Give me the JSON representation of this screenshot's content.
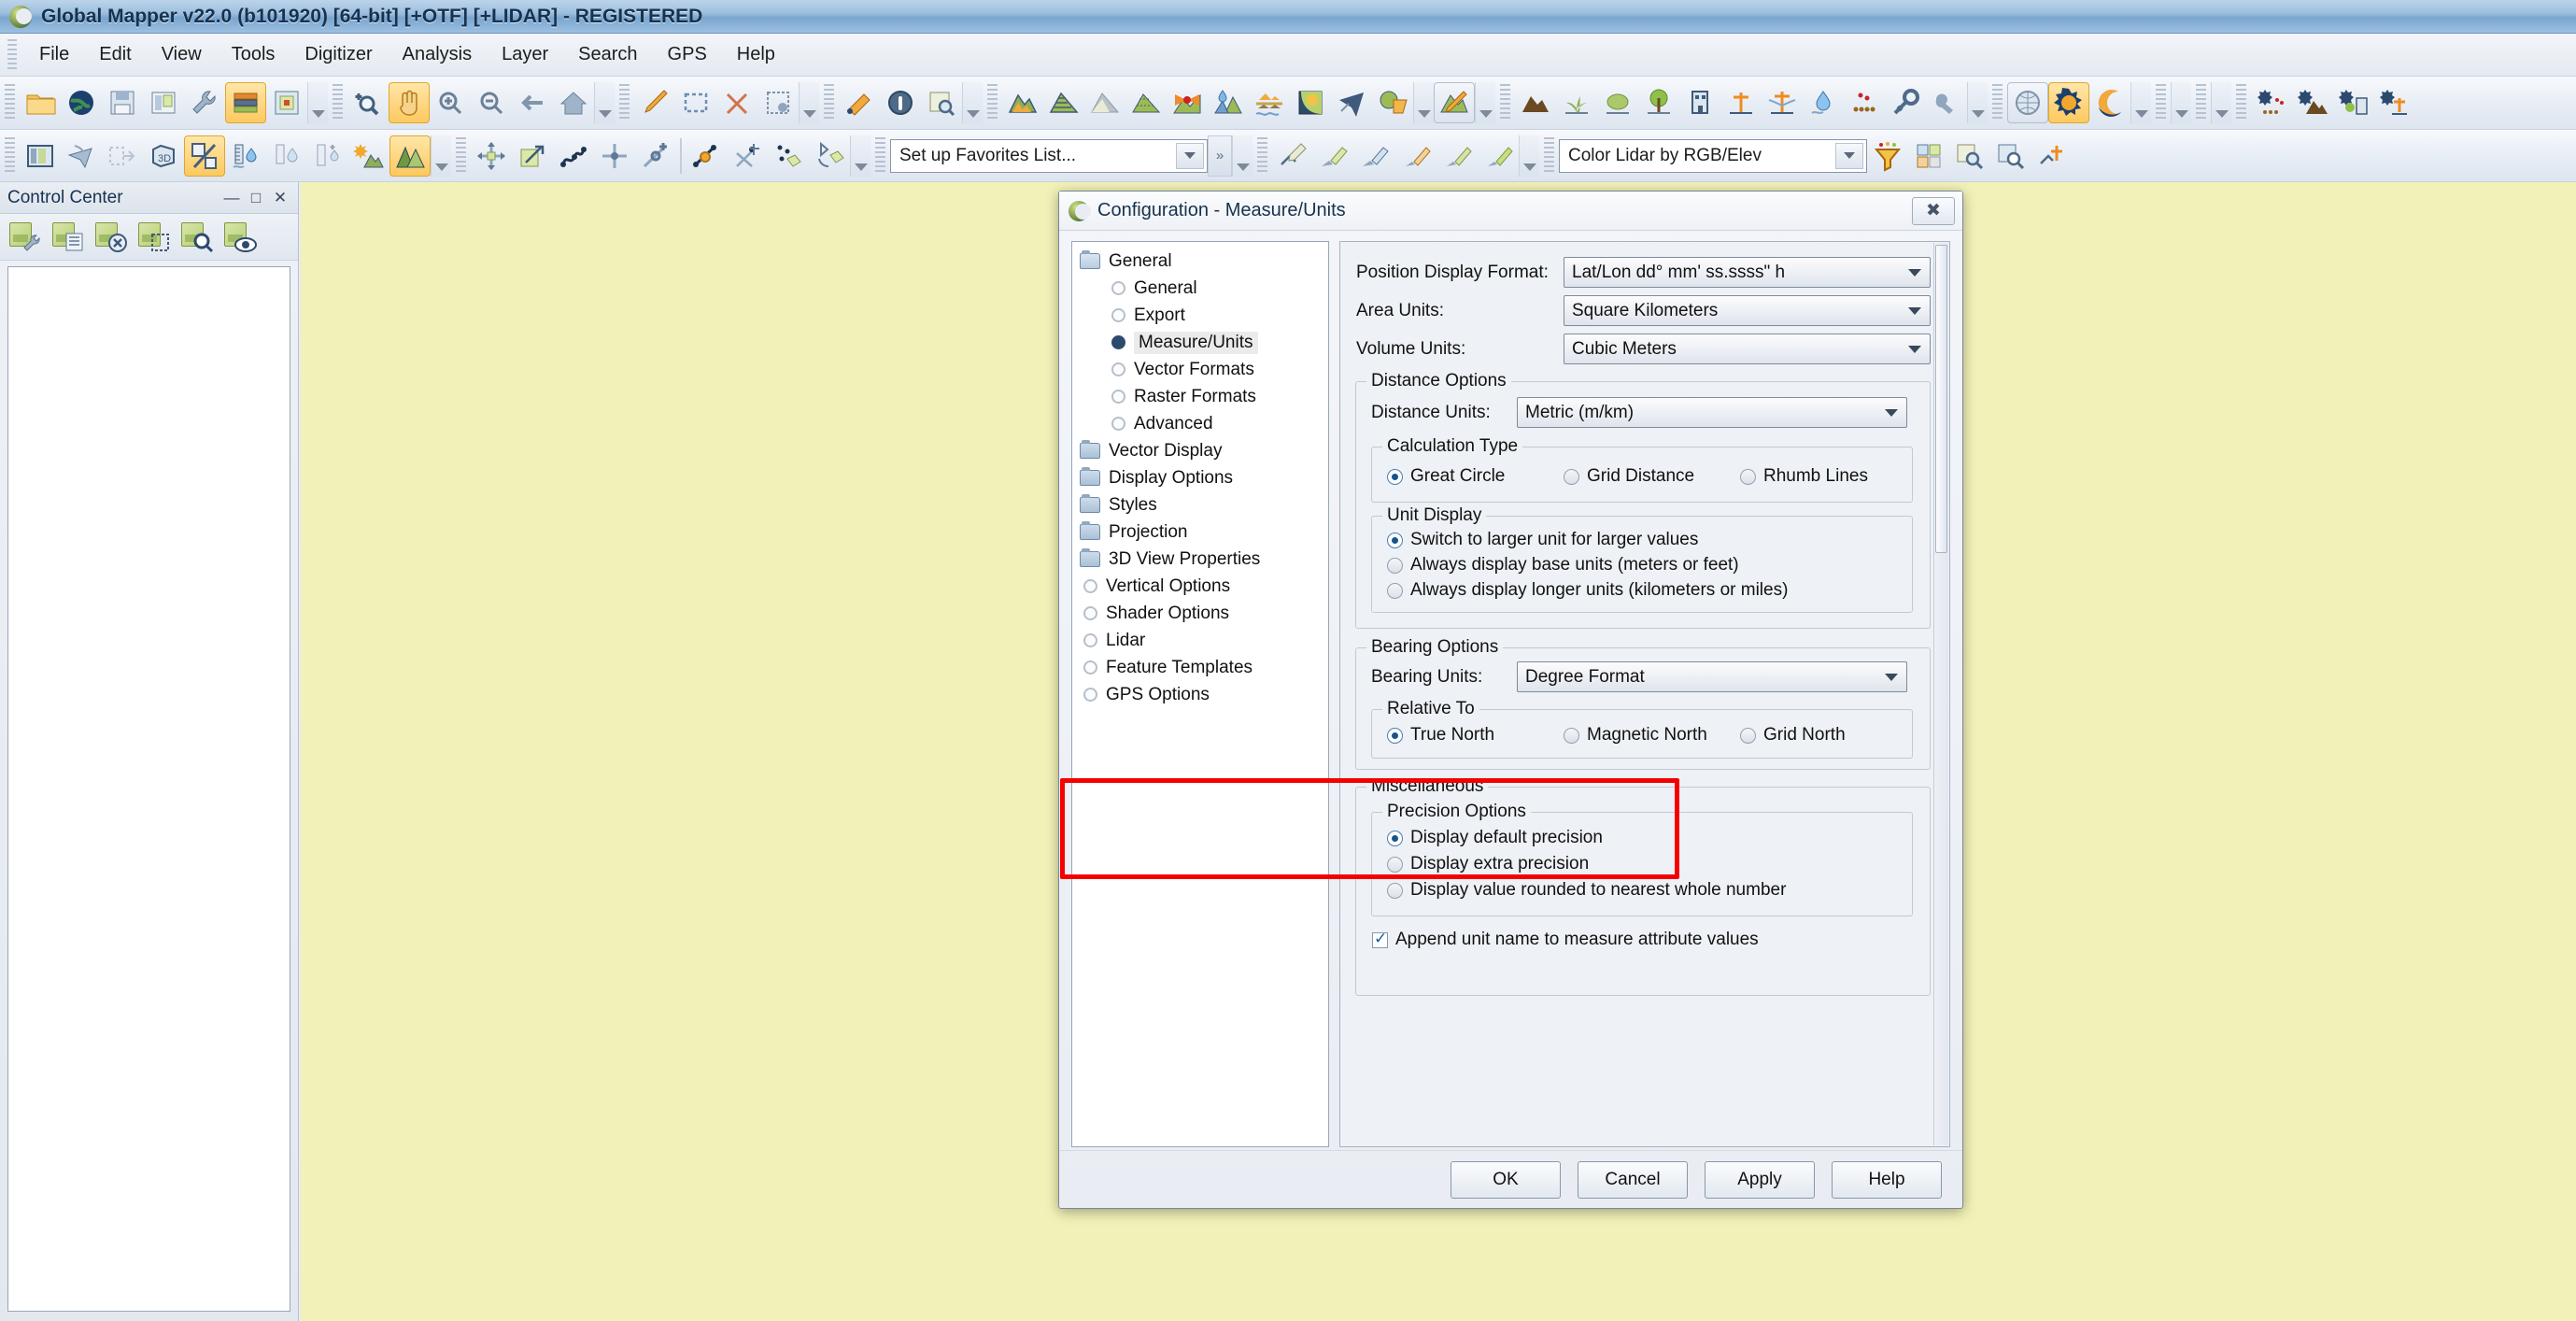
{
  "window": {
    "title": "Global Mapper v22.0 (b101920) [64-bit] [+OTF] [+LIDAR] - REGISTERED",
    "logo_icon": "globalmapper-logo-icon"
  },
  "menubar": {
    "items": [
      "File",
      "Edit",
      "View",
      "Tools",
      "Digitizer",
      "Analysis",
      "Layer",
      "Search",
      "GPS",
      "Help"
    ]
  },
  "toolbars": {
    "favorites_combo": {
      "value": "Set up Favorites List...",
      "placeholder": "Set up Favorites List..."
    },
    "lidar_combo": {
      "value": "Color Lidar by RGB/Elev",
      "placeholder": "Color Lidar by RGB/Elev"
    },
    "row1_icons": [
      "open-folder-icon",
      "open-data-online-icon",
      "save-workspace-icon",
      "print-icon",
      "configuration-wrench-icon",
      "control-center-icon",
      "overlay-control-icon",
      "zoom-select-icon",
      "pan-hand-icon",
      "zoom-in-icon",
      "zoom-out-icon",
      "back-arrow-icon",
      "full-view-home-icon",
      "digitizer-pencil-icon",
      "select-area-icon",
      "delete-feature-icon",
      "feature-info-icon",
      "measure-ruler-icon",
      "feature-info-circle-icon",
      "search-layer-icon",
      "terrain-layer-icon",
      "contour-icon",
      "shaded-relief-icon",
      "elevation-grid-icon",
      "view-shed-icon",
      "watershed-icon",
      "water-level-icon",
      "sun-shading-icon",
      "flight-path-icon",
      "combine-terrain-icon",
      "paint-terrain-icon",
      "mountain-point-icon",
      "grass-point-icon",
      "shrub-point-icon",
      "tree-point-icon",
      "building-point-icon",
      "utility-pole-icon",
      "power-line-icon",
      "water-drop-icon",
      "point-cloud-icon",
      "key-point-icon",
      "globe-view-icon",
      "gear-sun-icon",
      "moon-crescent-icon",
      "point-cloud-settings-icon",
      "terrain-settings-icon",
      "building-settings-icon",
      "pole-settings-icon"
    ],
    "row2_icons": [
      "control-center-panel-icon",
      "flight-path-2-icon",
      "export-bounds-icon",
      "three-d-view-icon",
      "percent-slope-icon",
      "water-gauge-icon",
      "water-gauge-2-icon",
      "water-gauge-3-icon",
      "sun-terrain-icon",
      "terrain-pair-icon",
      "pan-move-icon",
      "scale-move-icon",
      "path-profile-icon",
      "move-feature-icon",
      "rotate-feature-icon",
      "add-vertex-icon",
      "cut-feature-icon",
      "smooth-feature-icon",
      "rotate-shape-icon"
    ]
  },
  "control_center": {
    "title": "Control Center",
    "window_buttons": [
      "minimize",
      "maximize",
      "close"
    ],
    "toolbar_icons": [
      "layer-options-icon",
      "layer-metadata-icon",
      "layer-close-icon",
      "layer-bounds-icon",
      "layer-zoom-icon",
      "layer-visibility-icon"
    ]
  },
  "dialog": {
    "title": "Configuration - Measure/Units",
    "title_icon": "globalmapper-logo-icon",
    "close_icon": "close-icon",
    "tree": [
      {
        "label": "General",
        "type": "folder-open",
        "level": 0,
        "selected": false
      },
      {
        "label": "General",
        "type": "radio",
        "level": 1,
        "selected": false
      },
      {
        "label": "Export",
        "type": "radio",
        "level": 1,
        "selected": false
      },
      {
        "label": "Measure/Units",
        "type": "radio",
        "level": 1,
        "selected": true
      },
      {
        "label": "Vector Formats",
        "type": "radio",
        "level": 1,
        "selected": false
      },
      {
        "label": "Raster Formats",
        "type": "radio",
        "level": 1,
        "selected": false
      },
      {
        "label": "Advanced",
        "type": "radio",
        "level": 1,
        "selected": false
      },
      {
        "label": "Vector Display",
        "type": "folder",
        "level": 0,
        "selected": false
      },
      {
        "label": "Display Options",
        "type": "folder",
        "level": 0,
        "selected": false
      },
      {
        "label": "Styles",
        "type": "folder",
        "level": 0,
        "selected": false
      },
      {
        "label": "Projection",
        "type": "folder",
        "level": 0,
        "selected": false
      },
      {
        "label": "3D View Properties",
        "type": "folder",
        "level": 0,
        "selected": false
      },
      {
        "label": "Vertical Options",
        "type": "radio",
        "level": 0,
        "selected": false
      },
      {
        "label": "Shader Options",
        "type": "radio",
        "level": 0,
        "selected": false
      },
      {
        "label": "Lidar",
        "type": "radio",
        "level": 0,
        "selected": false
      },
      {
        "label": "Feature Templates",
        "type": "radio",
        "level": 0,
        "selected": false
      },
      {
        "label": "GPS Options",
        "type": "radio",
        "level": 0,
        "selected": false
      }
    ],
    "fields": {
      "position_display_format": {
        "label": "Position Display Format:",
        "value": "Lat/Lon dd° mm' ss.ssss\" h"
      },
      "area_units": {
        "label": "Area Units:",
        "value": "Square Kilometers"
      },
      "volume_units": {
        "label": "Volume Units:",
        "value": "Cubic Meters"
      }
    },
    "distance_options": {
      "caption": "Distance Options",
      "distance_units": {
        "label": "Distance Units:",
        "value": "Metric (m/km)"
      },
      "calculation_type": {
        "caption": "Calculation Type",
        "options": [
          "Great Circle",
          "Grid Distance",
          "Rhumb Lines"
        ],
        "selected": "Great Circle"
      },
      "unit_display": {
        "caption": "Unit Display",
        "options": [
          "Switch to larger unit for larger values",
          "Always display base units (meters or feet)",
          "Always display longer units (kilometers or miles)"
        ],
        "selected": "Switch to larger unit for larger values"
      }
    },
    "bearing_options": {
      "caption": "Bearing Options",
      "bearing_units": {
        "label": "Bearing Units:",
        "value": "Degree Format"
      },
      "relative_to": {
        "caption": "Relative To",
        "options": [
          "True North",
          "Magnetic North",
          "Grid North"
        ],
        "selected": "True North"
      }
    },
    "miscellaneous": {
      "caption": "Miscellaneous",
      "precision_options": {
        "caption": "Precision Options",
        "options": [
          "Display default precision",
          "Display extra precision",
          "Display value rounded to nearest whole number"
        ],
        "selected": "Display default precision"
      },
      "append_unit_name": {
        "label": "Append unit name to measure attribute values",
        "checked": true
      }
    },
    "buttons": [
      "OK",
      "Cancel",
      "Apply",
      "Help"
    ],
    "highlight_color": "#f50000"
  },
  "colors": {
    "map_background": "#f2f2b8",
    "titlebar": "#7ba6cf",
    "accent": "#17548f",
    "highlight": "#f50000"
  }
}
